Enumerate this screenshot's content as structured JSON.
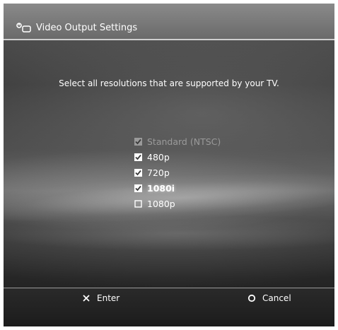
{
  "header": {
    "title": "Video Output Settings",
    "icon": "settings-toolbox-icon"
  },
  "prompt": "Select all resolutions that are supported by your TV.",
  "resolutions": [
    {
      "label": "Standard (NTSC)",
      "checked": true,
      "disabled": true,
      "selected": false
    },
    {
      "label": "480p",
      "checked": true,
      "disabled": false,
      "selected": false
    },
    {
      "label": "720p",
      "checked": true,
      "disabled": false,
      "selected": false
    },
    {
      "label": "1080i",
      "checked": true,
      "disabled": false,
      "selected": true
    },
    {
      "label": "1080p",
      "checked": false,
      "disabled": false,
      "selected": false
    }
  ],
  "footer": {
    "enter_label": "Enter",
    "enter_icon": "cross-button-icon",
    "cancel_label": "Cancel",
    "cancel_icon": "circle-button-icon"
  },
  "colors": {
    "text": "#ffffff",
    "disabled_text": "#9a9a9a"
  }
}
